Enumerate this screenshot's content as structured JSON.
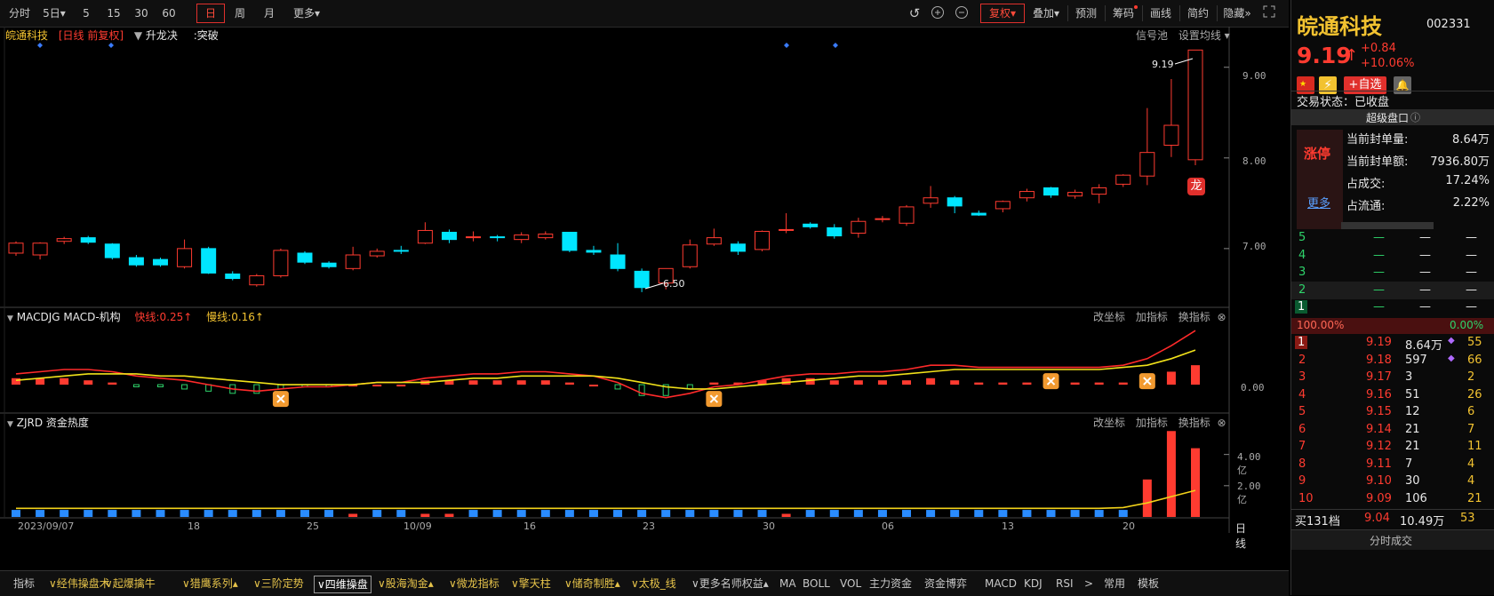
{
  "toolbar": {
    "left_items": [
      "分时",
      "5日▾",
      "5",
      "15",
      "30",
      "60",
      "日",
      "周",
      "月",
      "更多▾"
    ],
    "active_index": 6,
    "right_items": [
      "复权▾",
      "叠加▾",
      "预测",
      "筹码",
      "画线",
      "简约",
      "隐藏»"
    ]
  },
  "main_panel": {
    "stock_name": "皖通科技",
    "period_tag": "[日线 前复权]",
    "indicator": "升龙决",
    "signal": ":突破",
    "right_links": [
      "信号池",
      "设置均线 ▾"
    ],
    "y_ticks": [
      "9.00",
      "8.00",
      "7.00"
    ],
    "high_label": "9.19",
    "low_label": "6.50",
    "dragon_badge": "龙"
  },
  "macd_panel": {
    "title": "MACDJG MACD-机构",
    "fast": "快线:0.25↑",
    "slow": "慢线:0.16↑",
    "links": [
      "改坐标",
      "加指标",
      "换指标"
    ],
    "y_tick": "0.00"
  },
  "zjrd_panel": {
    "title": "ZJRD 资金热度",
    "links": [
      "改坐标",
      "加指标",
      "换指标"
    ],
    "y_ticks": [
      "4.00亿",
      "2.00亿"
    ]
  },
  "x_axis": {
    "labels": [
      "2023/09/07",
      "18",
      "25",
      "10/09",
      "16",
      "23",
      "30",
      "06",
      "13",
      "20"
    ],
    "period": "日线"
  },
  "bottom_tabs": [
    {
      "label": "指标",
      "style": "white"
    },
    {
      "label": "∨经伟操盘术",
      "style": "yellow"
    },
    {
      "label": "∨起爆擒牛",
      "style": "yellow"
    },
    {
      "label": "∨猎鹰系列▴",
      "style": "yellow"
    },
    {
      "label": "∨三阶定势",
      "style": "yellow"
    },
    {
      "label": "∨四维操盘",
      "style": "sel"
    },
    {
      "label": "∨股海淘金▴",
      "style": "yellow"
    },
    {
      "label": "∨微龙指标",
      "style": "yellow"
    },
    {
      "label": "∨擎天柱",
      "style": "yellow"
    },
    {
      "label": "∨储奇制胜▴",
      "style": "yellow"
    },
    {
      "label": "∨太极_线",
      "style": "yellow"
    },
    {
      "label": "∨更多名师权益▴",
      "style": "white"
    },
    {
      "label": "MA",
      "style": "white"
    },
    {
      "label": "BOLL",
      "style": "white"
    },
    {
      "label": "VOL",
      "style": "white"
    },
    {
      "label": "主力资金",
      "style": "white"
    },
    {
      "label": "资金博弈",
      "style": "white"
    },
    {
      "label": "MACD",
      "style": "white"
    },
    {
      "label": "KDJ",
      "style": "white"
    },
    {
      "label": "RSI",
      "style": "white"
    },
    {
      "label": ">",
      "style": "white"
    },
    {
      "label": "常用",
      "style": "white"
    },
    {
      "label": "模板",
      "style": "white"
    }
  ],
  "quote": {
    "name": "皖通科技",
    "code": "002331",
    "price": "9.19",
    "arrow": "↑",
    "change": "+0.84",
    "change_pct": "+10.06%",
    "add_watch": "+自选",
    "trade_status": "交易状态：已收盘",
    "super_board": "超级盘口",
    "limit_label": "涨停",
    "more": "更多",
    "stats": [
      {
        "k": "当前封单量:",
        "v": "8.64万"
      },
      {
        "k": "当前封单额:",
        "v": "7936.80万"
      },
      {
        "k": "占成交:",
        "v": "17.24%"
      },
      {
        "k": "占流通:",
        "v": "2.22%"
      }
    ],
    "asks": [
      {
        "lvl": "5",
        "p": "—",
        "v": "—",
        "x": "—"
      },
      {
        "lvl": "4",
        "p": "—",
        "v": "—",
        "x": "—"
      },
      {
        "lvl": "3",
        "p": "—",
        "v": "—",
        "x": "—"
      },
      {
        "lvl": "2",
        "p": "—",
        "v": "—",
        "x": "—"
      },
      {
        "lvl": "1",
        "p": "—",
        "v": "—",
        "x": "—"
      }
    ],
    "ratio_left": "100.00%",
    "ratio_right": "0.00%",
    "bids": [
      {
        "lvl": "1",
        "p": "9.19",
        "v": "8.64万",
        "x": "55"
      },
      {
        "lvl": "2",
        "p": "9.18",
        "v": "597",
        "x": "66"
      },
      {
        "lvl": "3",
        "p": "9.17",
        "v": "3",
        "x": "2"
      },
      {
        "lvl": "4",
        "p": "9.16",
        "v": "51",
        "x": "26"
      },
      {
        "lvl": "5",
        "p": "9.15",
        "v": "12",
        "x": "6"
      },
      {
        "lvl": "6",
        "p": "9.14",
        "v": "21",
        "x": "7"
      },
      {
        "lvl": "7",
        "p": "9.12",
        "v": "21",
        "x": "11"
      },
      {
        "lvl": "8",
        "p": "9.11",
        "v": "7",
        "x": "4"
      },
      {
        "lvl": "9",
        "p": "9.10",
        "v": "30",
        "x": "4"
      },
      {
        "lvl": "10",
        "p": "9.09",
        "v": "106",
        "x": "21"
      }
    ],
    "buy_total": {
      "k": "买131档",
      "p": "9.04",
      "v": "10.49万",
      "x": "53"
    },
    "footer": "分时成交"
  },
  "chart_data": {
    "type": "candlestick",
    "candles": [
      [
        6.95,
        7.06,
        6.92,
        7.08
      ],
      [
        6.93,
        7.06,
        6.88,
        7.07
      ],
      [
        7.08,
        7.11,
        7.05,
        7.13
      ],
      [
        7.12,
        7.07,
        7.05,
        7.14
      ],
      [
        7.05,
        6.9,
        6.88,
        7.06
      ],
      [
        6.9,
        6.82,
        6.8,
        6.93
      ],
      [
        6.88,
        6.82,
        6.8,
        6.9
      ],
      [
        6.8,
        7.0,
        6.78,
        7.1
      ],
      [
        7.0,
        6.73,
        6.72,
        7.02
      ],
      [
        6.72,
        6.67,
        6.65,
        6.75
      ],
      [
        6.6,
        6.7,
        6.58,
        6.72
      ],
      [
        6.7,
        6.98,
        6.68,
        7.0
      ],
      [
        6.95,
        6.85,
        6.83,
        6.97
      ],
      [
        6.84,
        6.8,
        6.78,
        6.86
      ],
      [
        6.78,
        6.93,
        6.76,
        7.02
      ],
      [
        6.92,
        6.97,
        6.9,
        7.0
      ],
      [
        6.98,
        6.97,
        6.94,
        7.03
      ],
      [
        7.06,
        7.2,
        7.05,
        7.29
      ],
      [
        7.18,
        7.1,
        7.06,
        7.21
      ],
      [
        7.12,
        7.13,
        7.08,
        7.19
      ],
      [
        7.13,
        7.12,
        7.08,
        7.15
      ],
      [
        7.1,
        7.15,
        7.06,
        7.18
      ],
      [
        7.12,
        7.16,
        7.1,
        7.19
      ],
      [
        7.18,
        6.98,
        6.96,
        7.18
      ],
      [
        6.98,
        6.96,
        6.93,
        7.03
      ],
      [
        6.93,
        6.78,
        6.75,
        7.06
      ],
      [
        6.75,
        6.57,
        6.52,
        6.78
      ],
      [
        6.62,
        6.78,
        6.55,
        6.78
      ],
      [
        6.8,
        7.04,
        6.78,
        7.1
      ],
      [
        7.05,
        7.12,
        7.03,
        7.22
      ],
      [
        7.05,
        6.97,
        6.93,
        7.08
      ],
      [
        6.99,
        7.19,
        6.97,
        7.2
      ],
      [
        7.2,
        7.21,
        7.17,
        7.39
      ],
      [
        7.27,
        7.24,
        7.22,
        7.29
      ],
      [
        7.23,
        7.14,
        7.11,
        7.27
      ],
      [
        7.17,
        7.3,
        7.12,
        7.34
      ],
      [
        7.32,
        7.33,
        7.29,
        7.36
      ],
      [
        7.28,
        7.46,
        7.25,
        7.48
      ],
      [
        7.5,
        7.56,
        7.45,
        7.69
      ],
      [
        7.56,
        7.47,
        7.39,
        7.58
      ],
      [
        7.39,
        7.37,
        7.36,
        7.42
      ],
      [
        7.44,
        7.52,
        7.4,
        7.53
      ],
      [
        7.56,
        7.63,
        7.52,
        7.66
      ],
      [
        7.67,
        7.59,
        7.56,
        7.68
      ],
      [
        7.58,
        7.62,
        7.55,
        7.65
      ],
      [
        7.6,
        7.67,
        7.5,
        7.71
      ],
      [
        7.71,
        7.81,
        7.68,
        7.82
      ],
      [
        7.8,
        8.06,
        7.7,
        8.55
      ],
      [
        8.14,
        8.36,
        8.01,
        8.87
      ],
      [
        7.98,
        9.19,
        7.92,
        9.19
      ]
    ],
    "candle_fields": [
      "open",
      "close",
      "low",
      "high"
    ],
    "y_range": [
      6.45,
      9.35
    ],
    "y_ticks": [
      7.0,
      8.0,
      9.0
    ],
    "macd_fast": [
      0.05,
      0.06,
      0.07,
      0.07,
      0.06,
      0.04,
      0.03,
      0.02,
      0.0,
      -0.02,
      -0.03,
      -0.02,
      -0.01,
      -0.01,
      0.0,
      0.01,
      0.01,
      0.03,
      0.04,
      0.05,
      0.05,
      0.06,
      0.06,
      0.05,
      0.04,
      0.01,
      -0.04,
      -0.06,
      -0.04,
      -0.01,
      0.0,
      0.02,
      0.04,
      0.05,
      0.05,
      0.06,
      0.06,
      0.07,
      0.09,
      0.09,
      0.08,
      0.08,
      0.08,
      0.08,
      0.08,
      0.08,
      0.09,
      0.12,
      0.18,
      0.25
    ],
    "macd_slow": [
      0.02,
      0.03,
      0.04,
      0.05,
      0.05,
      0.05,
      0.04,
      0.04,
      0.03,
      0.02,
      0.01,
      0.0,
      0.0,
      0.0,
      0.0,
      0.01,
      0.01,
      0.01,
      0.02,
      0.03,
      0.03,
      0.04,
      0.04,
      0.04,
      0.04,
      0.03,
      0.01,
      -0.01,
      -0.02,
      -0.02,
      -0.01,
      0.0,
      0.01,
      0.02,
      0.03,
      0.04,
      0.04,
      0.05,
      0.06,
      0.07,
      0.07,
      0.07,
      0.07,
      0.07,
      0.07,
      0.07,
      0.08,
      0.09,
      0.12,
      0.16
    ],
    "macd_range": [
      -0.09,
      0.3
    ],
    "heat": [
      0.1,
      0.1,
      0.1,
      0.1,
      0.1,
      0.1,
      0.1,
      0.1,
      0.1,
      0.1,
      0.1,
      0.1,
      0.1,
      0.1,
      0.2,
      0.1,
      0.1,
      0.2,
      0.2,
      0.1,
      0.1,
      0.1,
      0.1,
      0.1,
      0.1,
      0.1,
      0.1,
      0.1,
      0.1,
      0.1,
      0.1,
      0.1,
      0.2,
      0.1,
      0.1,
      0.1,
      0.1,
      0.1,
      0.1,
      0.1,
      0.1,
      0.1,
      0.1,
      0.1,
      0.1,
      0.1,
      0.1,
      2.4,
      5.5,
      4.4
    ],
    "heat_ma": [
      0.55,
      0.55,
      0.55,
      0.55,
      0.55,
      0.55,
      0.55,
      0.55,
      0.55,
      0.55,
      0.55,
      0.55,
      0.55,
      0.55,
      0.55,
      0.55,
      0.55,
      0.55,
      0.55,
      0.55,
      0.55,
      0.55,
      0.55,
      0.55,
      0.55,
      0.55,
      0.55,
      0.55,
      0.55,
      0.55,
      0.55,
      0.55,
      0.55,
      0.55,
      0.55,
      0.55,
      0.55,
      0.55,
      0.55,
      0.55,
      0.55,
      0.55,
      0.55,
      0.55,
      0.55,
      0.55,
      0.6,
      0.9,
      1.3,
      1.7
    ],
    "heat_range": [
      0,
      5.8
    ],
    "colors": {
      "up": "#ff3b30",
      "down": "#00e5ff",
      "yellow": "#f2d21a",
      "blue": "#2a8cff",
      "macd_fast": "#ff2a2a",
      "macd_slow": "#f2e21a"
    }
  }
}
